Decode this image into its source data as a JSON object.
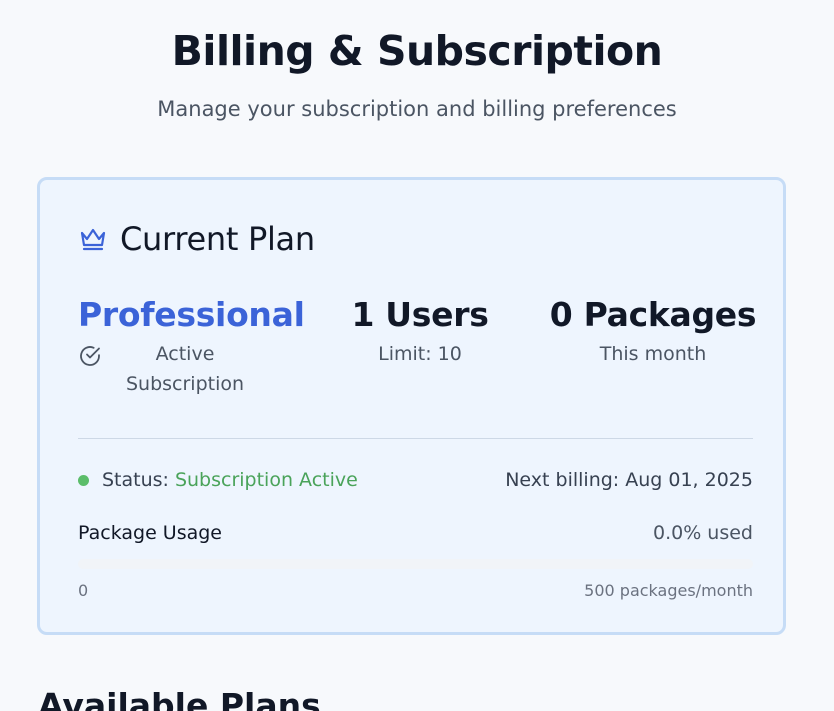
{
  "header": {
    "title": "Billing & Subscription",
    "subtitle": "Manage your subscription and billing preferences"
  },
  "current_plan": {
    "title": "Current Plan",
    "icon": "crown-icon",
    "plan_name": "Professional",
    "plan_status_icon": "check-circle-icon",
    "plan_status_text": "Active Subscription",
    "users_value": "1 Users",
    "users_sub": "Limit: 10",
    "packages_value": "0 Packages",
    "packages_sub": "This month",
    "status_label": "Status:",
    "status_value": "Subscription Active",
    "next_billing": "Next billing: Aug 01, 2025",
    "usage_label": "Package Usage",
    "usage_percent_text": "0.0% used",
    "usage_fraction": 0.0,
    "scale_min": "0",
    "scale_max": "500 packages/month"
  },
  "available_plans": {
    "title": "Available Plans"
  },
  "colors": {
    "accent": "#3b63d8",
    "status_green": "#4aa35a",
    "card_border": "#c6dcf6",
    "card_bg": "#eef5fe"
  }
}
